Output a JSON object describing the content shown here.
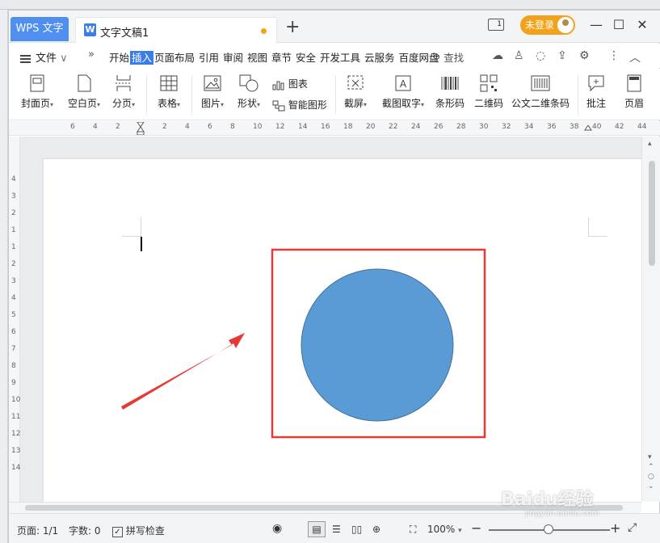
{
  "titlebar": {
    "app_tab": "WPS 文字",
    "doc_tab": "文字文稿1",
    "login_label": "未登录"
  },
  "menubar": {
    "file_label": "文件",
    "items": [
      "开始",
      "插入",
      "页面布局",
      "引用",
      "审阅",
      "视图",
      "章节",
      "安全",
      "开发工具",
      "云服务",
      "百度网盘"
    ],
    "active_item": "插入",
    "search_label": "查找"
  },
  "ribbon": {
    "cover_page": "封面页",
    "blank_page": "空白页",
    "page_break": "分页",
    "table": "表格",
    "picture": "图片",
    "shape": "形状",
    "chart": "图表",
    "smart_art": "智能图形",
    "screenshot": "截屏",
    "screenshot_ocr": "截图取字",
    "barcode": "条形码",
    "qrcode": "二维码",
    "pdf417": "公文二维条码",
    "comment": "批注",
    "header": "页眉"
  },
  "ruler": {
    "top_ticks": [
      "6",
      "4",
      "2",
      "2",
      "4",
      "6",
      "8",
      "10",
      "12",
      "14",
      "16",
      "18",
      "20",
      "22",
      "24",
      "26",
      "28",
      "30",
      "32",
      "34",
      "36",
      "38",
      "40",
      "42",
      "44"
    ],
    "left_ticks": [
      "4",
      "3",
      "2",
      "1",
      "1",
      "2",
      "3",
      "4",
      "5",
      "6",
      "7",
      "8",
      "9",
      "10",
      "11",
      "12",
      "13",
      "14"
    ]
  },
  "document": {
    "shape_fill": "#5b9bd5",
    "shape_stroke": "#41719c",
    "highlight_color": "#e53935",
    "arrow_color": "#e53935"
  },
  "statusbar": {
    "page": "页面: 1/1",
    "words": "字数: 0",
    "spell_check": "拼写检查",
    "zoom": "100%"
  },
  "watermark": {
    "text": "Baidu经验",
    "sub": "jingyan.baidu.com"
  }
}
